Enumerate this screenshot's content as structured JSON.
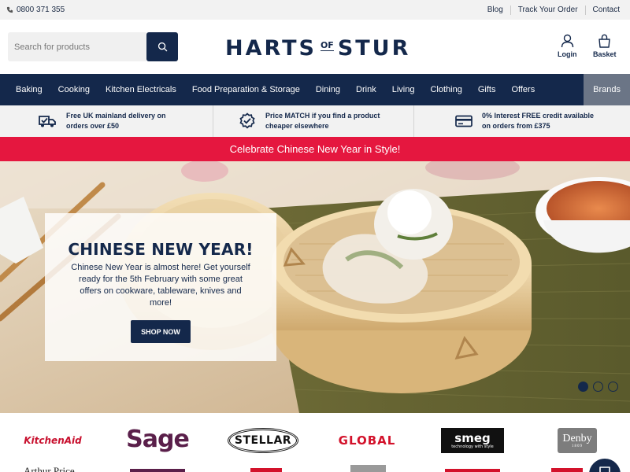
{
  "topbar": {
    "phone": "0800 371 355",
    "links": [
      "Blog",
      "Track Your Order",
      "Contact"
    ]
  },
  "header": {
    "search_placeholder": "Search for products",
    "logo": {
      "left": "HARTS",
      "mid": "OF",
      "right": "STUR"
    },
    "login": "Login",
    "basket": "Basket"
  },
  "nav": [
    "Baking",
    "Cooking",
    "Kitchen Electricals",
    "Food Preparation & Storage",
    "Dining",
    "Drink",
    "Living",
    "Clothing",
    "Gifts",
    "Offers",
    "Brands"
  ],
  "usp": [
    {
      "line1": "Free UK mainland delivery on",
      "line2": "orders over £50",
      "icon": "delivery-truck-icon"
    },
    {
      "line1": "Price MATCH if you find a product",
      "line2": "cheaper elsewhere",
      "icon": "price-match-badge-icon"
    },
    {
      "line1": "0% Interest FREE credit available",
      "line2": "on orders from £375",
      "icon": "credit-card-icon"
    }
  ],
  "promo": "Celebrate Chinese New Year in Style!",
  "hero": {
    "title": "CHINESE NEW YEAR!",
    "body": "Chinese New Year is almost here! Get yourself ready for the 5th February with some great offers on cookware, tableware, knives and more!",
    "cta": "SHOP NOW",
    "active_slide": 1,
    "slides": 3
  },
  "brands": [
    "KitchenAid",
    "Sage",
    "STELLAR",
    "GLOBAL",
    "smeg",
    "Denby"
  ],
  "brand_details": {
    "smeg_tagline": "technology with style",
    "denby_year": "1809"
  },
  "brands_row2": [
    "Arthur Price"
  ],
  "colors": {
    "navy": "#14284b",
    "promo_red": "#e5173f",
    "nav_highlight": "#6b7586",
    "kitchenaid_red": "#c8102e",
    "sage_purple": "#5a1f4a",
    "global_red": "#d3122b"
  }
}
